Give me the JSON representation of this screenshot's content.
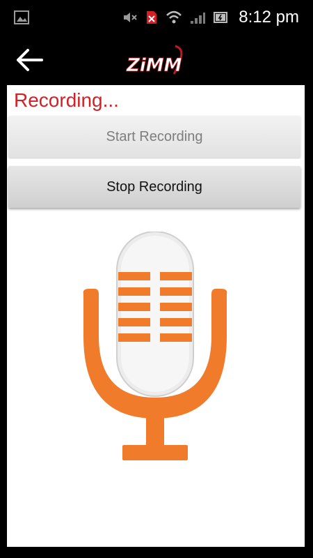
{
  "status_bar": {
    "time": "8:12 pm",
    "icons": [
      "gallery-icon",
      "mute-icon",
      "sim-icon",
      "wifi-icon",
      "signal-icon",
      "battery-icon"
    ]
  },
  "app_bar": {
    "logo_text": "ZiMM",
    "back_icon": "back-arrow-icon"
  },
  "main": {
    "status_text": "Recording...",
    "start_button": "Start Recording",
    "stop_button": "Stop Recording",
    "mic_icon": "microphone-icon"
  },
  "colors": {
    "accent_orange": "#f07b2a",
    "status_red": "#d31f26"
  }
}
